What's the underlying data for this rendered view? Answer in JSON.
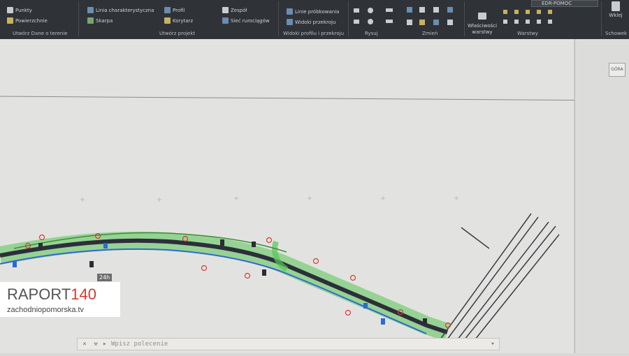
{
  "ribbon": {
    "groups": [
      {
        "label": "Utwórz Dane o terenie",
        "items": [
          "Punkty",
          "Powierzchnie"
        ]
      },
      {
        "label": "Utwórz projekt",
        "items": [
          "Linia charakterystyczna",
          "Skarpa",
          "Profil",
          "Korytarz",
          "Zespół",
          "Sieć rurociągów"
        ]
      },
      {
        "label": "Widoki profilu i przekroju",
        "items": [
          "Linie próbkowania",
          "Widoki przekroju"
        ]
      },
      {
        "label": "Rysuj",
        "items": []
      },
      {
        "label": "Zmień",
        "items": []
      },
      {
        "label": "Warstwy",
        "items": [
          "Właściwości warstwy"
        ]
      }
    ],
    "layer_dropdown": "EDR-POMOC",
    "clipboard_label": "Schowek",
    "paste_label": "Wklej"
  },
  "viewcube": {
    "face": "GÓRA"
  },
  "command_line": {
    "placeholder": "Wpisz polecenie"
  },
  "broadcast_logo": {
    "badge": "24h",
    "brand": "RAPORT",
    "number": "140",
    "url": "zachodniopomorska.tv"
  },
  "colors": {
    "ribbon_bg": "#2f3337",
    "canvas_bg": "#e2e3e0",
    "road_green": "#4cc24a",
    "road_dark": "#2c2f3a",
    "logo_red": "#d43b2f"
  }
}
